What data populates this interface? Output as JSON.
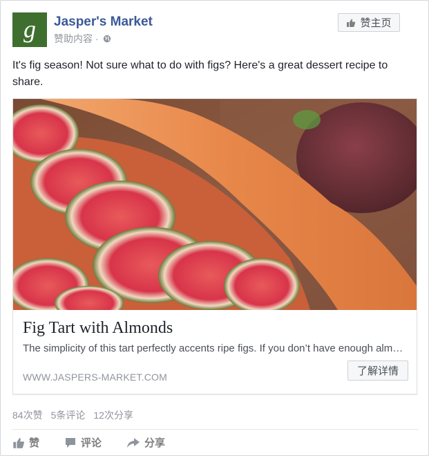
{
  "post": {
    "page_name": "Jasper's Market",
    "sponsored_label": "赞助内容",
    "separator": "·",
    "like_page_label": "赞主页",
    "text": "It's fig season! Not sure what to do with figs? Here's a great dessert recipe to share."
  },
  "link": {
    "title": "Fig Tart with Almonds",
    "description": "The simplicity of this tart perfectly accents ripe figs. If you don’t have enough almonds, substitute with walnuts.",
    "domain": "WWW.JASPERS-MARKET.COM",
    "cta_label": "了解详情"
  },
  "stats": {
    "likes": "84次赞",
    "comments": "5条评论",
    "shares": "12次分享"
  },
  "actions": {
    "like": "赞",
    "comment": "评论",
    "share": "分享"
  },
  "icons": {
    "logo": "jaspers-market-logo",
    "globe": "globe-icon",
    "thumb": "thumbs-up-icon",
    "comment": "comment-icon",
    "share": "share-icon"
  },
  "colors": {
    "brand_blue": "#3b5998",
    "logo_green": "#3f6f2f",
    "muted": "#90949c"
  }
}
